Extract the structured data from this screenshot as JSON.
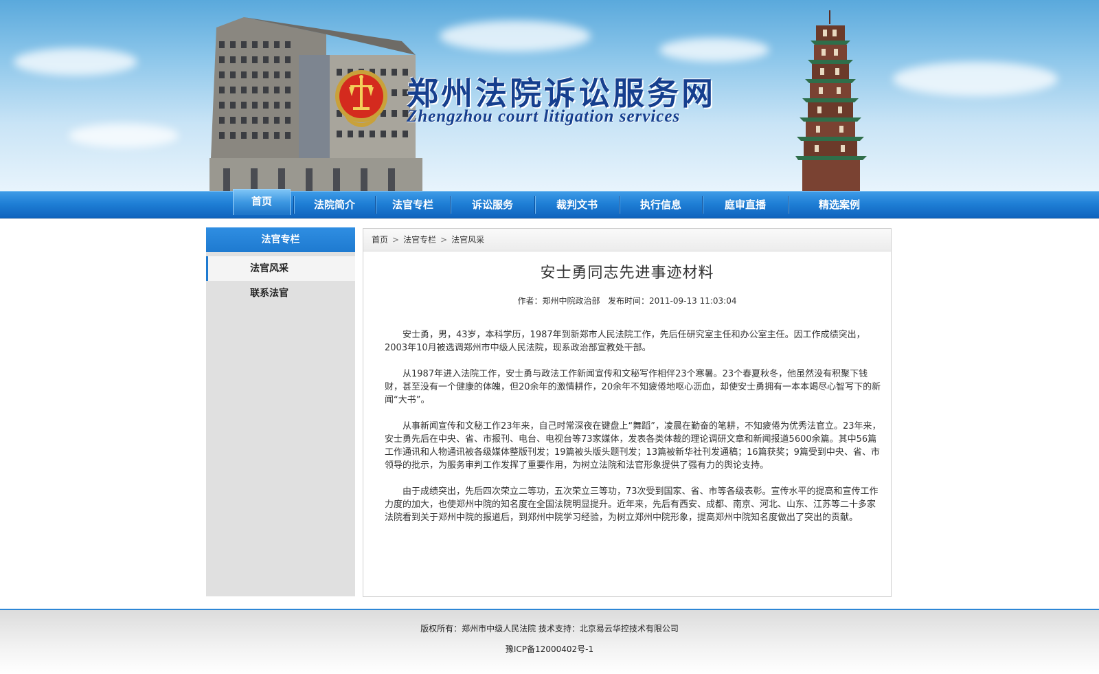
{
  "site": {
    "title_cn": "郑州法院诉讼服务网",
    "title_en": "Zhengzhou court litigation services"
  },
  "nav": {
    "items": [
      {
        "label": "首页"
      },
      {
        "label": "法院简介"
      },
      {
        "label": "法官专栏"
      },
      {
        "label": "诉讼服务"
      },
      {
        "label": "裁判文书"
      },
      {
        "label": "执行信息"
      },
      {
        "label": "庭审直播"
      },
      {
        "label": "精选案例"
      }
    ],
    "active_color": "#3c97e1",
    "bar_color": "#1f7fd6"
  },
  "sidebar": {
    "heading": "法官专栏",
    "items": [
      {
        "label": "法官风采"
      },
      {
        "label": "联系法官"
      }
    ]
  },
  "breadcrumb": [
    "首页",
    "法官专栏",
    "法官风采"
  ],
  "article": {
    "title": "安士勇同志先进事迹材料",
    "author_label": "作者：",
    "author": "郑州中院政治部",
    "date_label": "发布时间：",
    "date": "2011-09-13 11:03:04",
    "paragraphs": [
      "安士勇，男，43岁，本科学历，1987年到新郑市人民法院工作，先后任研究室主任和办公室主任。因工作成绩突出，2003年10月被选调郑州市中级人民法院，现系政治部宣教处干部。",
      "从1987年进入法院工作，安士勇与政法工作新闻宣传和文秘写作相伴23个寒暑。23个春夏秋冬，他虽然没有积聚下钱财，甚至没有一个健康的体魄，但20余年的激情耕作，20余年不知疲倦地呕心沥血，却使安士勇拥有一本本竭尽心智写下的新闻“大书”。",
      "从事新闻宣传和文秘工作23年来，自己时常深夜在键盘上“舞蹈”，凌晨在勤奋的笔耕，不知疲倦为优秀法官立。23年来，安士勇先后在中央、省、市报刊、电台、电视台等73家媒体，发表各类体裁的理论调研文章和新闻报道5600余篇。其中56篇工作通讯和人物通讯被各级媒体整版刊发；19篇被头版头题刊发；13篇被新华社刊发通稿；16篇获奖；9篇受到中央、省、市领导的批示，为服务审判工作发挥了重要作用，为树立法院和法官形象提供了强有力的舆论支持。",
      "由于成绩突出，先后四次荣立二等功，五次荣立三等功，73次受到国家、省、市等各级表彰。宣传水平的提高和宣传工作力度的加大，也使郑州中院的知名度在全国法院明显提升。近年来，先后有西安、成都、南京、河北、山东、江苏等二十多家法院看到关于郑州中院的报道后，到郑州中院学习经验，为树立郑州中院形象，提高郑州中院知名度做出了突出的贡献。"
    ]
  },
  "footer": {
    "copyright": "版权所有：郑州市中级人民法院  技术支持：北京易云华控技术有限公司",
    "icp": "豫ICP备12000402号-1"
  }
}
